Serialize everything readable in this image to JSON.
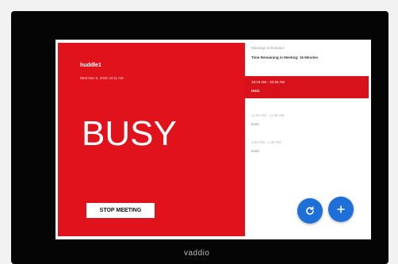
{
  "device": {
    "brand_logo": "vaddio"
  },
  "status_panel": {
    "room_name": "huddle1",
    "datetime": "Wed Nov 6, 2019 10:11 AM",
    "status": "BUSY",
    "stop_button_label": "STOP MEETING",
    "color": "#e0121c"
  },
  "schedule": {
    "header": "Meetings Scheduled",
    "room_subtitle": "Time Remaining in Meeting: 16 Minutes",
    "items": [
      {
        "time": "10:10 AM - 10:30 AM",
        "title": "test1",
        "active": true
      },
      {
        "time": "11:00 AM - 11:30 AM",
        "title": "test2",
        "active": false
      },
      {
        "time": "1:00 PM - 1:30 PM",
        "title": "test3",
        "active": false
      }
    ]
  },
  "actions": {
    "refresh_icon": "refresh-icon",
    "add_icon": "plus-icon",
    "accent_color": "#1f6fd8"
  }
}
